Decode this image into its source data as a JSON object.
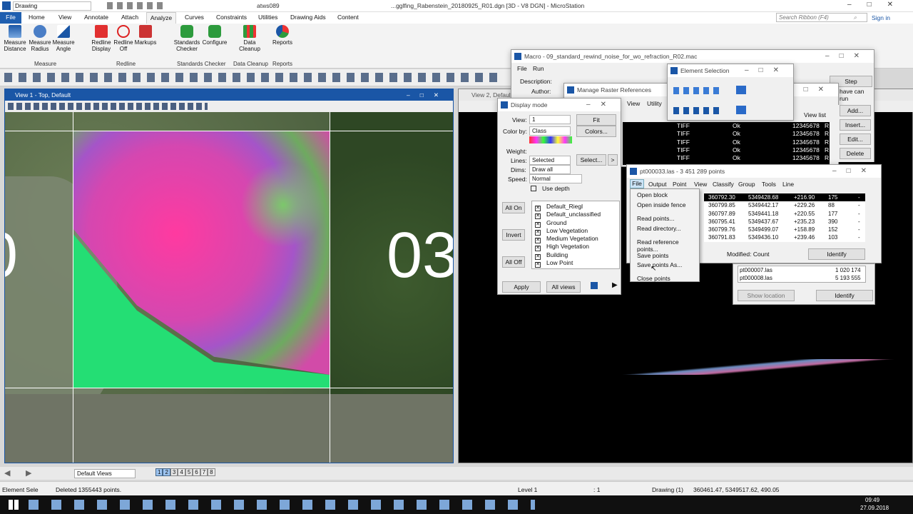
{
  "app": {
    "title": "atws089",
    "doc": "...gglfing_Rabenstein_20180925_R01.dgn [3D - V8 DGN] - MicroStation",
    "workflow": "Drawing",
    "search_placeholder": "Search Ribbon (F4)",
    "sign_in": "Sign in"
  },
  "tabs": [
    "File",
    "Home",
    "View",
    "Annotate",
    "Attach",
    "Analyze",
    "Curves",
    "Constraints",
    "Utilities",
    "Drawing Aids",
    "Content"
  ],
  "ribbon": {
    "buttons": [
      "Measure Distance",
      "Measure Radius",
      "Measure Angle",
      "Redline Display",
      "Redline Off",
      "Markups",
      "Standards Checker",
      "Configure",
      "Data Cleanup",
      "Reports"
    ],
    "groups": [
      "Measure",
      "Redline",
      "Standards Checker",
      "Data Cleanup",
      "Reports"
    ]
  },
  "view1": {
    "title": "View 1 - Top, Default",
    "overlay_text": "03",
    "overlay_text_left": "0"
  },
  "view2": {
    "title": "View 2, Default"
  },
  "macro": {
    "title": "Macro - 09_standard_rewind_noise_for_wo_refraction_R02.mac",
    "menu": [
      "File",
      "Run"
    ],
    "description_label": "Description:",
    "author_label": "Author:",
    "step": "Step",
    "run_note": "have can run"
  },
  "element_selection": {
    "title": "Element Selection"
  },
  "raster": {
    "title": "Manage Raster References",
    "menu": [
      "View",
      "Utility"
    ],
    "view_list": "View list",
    "buttons": [
      "Add...",
      "Insert...",
      "Edit...",
      "Delete"
    ],
    "rows": [
      [
        "TIFF",
        "Ok",
        "12345678",
        "R"
      ],
      [
        "TIFF",
        "Ok",
        "12345678",
        "R"
      ],
      [
        "TIFF",
        "Ok",
        "12345678",
        "R"
      ],
      [
        "TIFF",
        "Ok",
        "12345678",
        "R"
      ],
      [
        "TIFF",
        "Ok",
        "12345678",
        "R"
      ]
    ]
  },
  "display_mode": {
    "title": "Display mode",
    "labels": [
      "View:",
      "Color by:",
      "Weight:",
      "Lines:",
      "Dims:",
      "Speed:"
    ],
    "values": {
      "view": "1",
      "color_by": "Class",
      "lines": "Selected",
      "dims": "Draw all",
      "speed": "Normal"
    },
    "fit": "Fit",
    "colors": "Colors...",
    "select": "Select...",
    "use_depth": "Use depth",
    "side_buttons": [
      "All On",
      "Invert",
      "All Off"
    ],
    "classes": [
      "Default_Riegl",
      "Default_unclassified",
      "Ground",
      "Low Vegetation",
      "Medium Vegetation",
      "High Vegetation",
      "Building",
      "Low Point"
    ],
    "apply": "Apply",
    "all_views": "All views"
  },
  "points_window": {
    "title": "pt000033.las - 3 451 289 points",
    "menu": [
      "File",
      "Output",
      "Point",
      "View",
      "Classify",
      "Group",
      "Tools",
      "Line"
    ],
    "file_menu": [
      "Open block",
      "Open inside fence",
      "Read points...",
      "Read directory...",
      "Read reference points...",
      "Save points",
      "Save points As...",
      "Close points"
    ],
    "rows": [
      [
        "360792.30",
        "5349428.68",
        "+216.90",
        "175",
        "-"
      ],
      [
        "360799.85",
        "5349442.17",
        "+229.26",
        "88",
        "-"
      ],
      [
        "360797.89",
        "5349441.18",
        "+220.55",
        "177",
        "-"
      ],
      [
        "360795.41",
        "5349437.67",
        "+235.23",
        "390",
        "-"
      ],
      [
        "360799.76",
        "5349499.07",
        "+158.89",
        "152",
        "-"
      ],
      [
        "360791.83",
        "5349436.10",
        "+239.46",
        "103",
        "-"
      ]
    ],
    "modified": "Modified: Count",
    "identify": "Identify"
  },
  "files_panel": {
    "rows": [
      [
        "pt000007.las",
        "1 020 174"
      ],
      [
        "pt000008.las",
        "5 193 555"
      ]
    ],
    "show_location": "Show location",
    "identify": "Identify"
  },
  "viewbar": {
    "label": "Default Views",
    "numbers": [
      "1",
      "2",
      "3",
      "4",
      "5",
      "6",
      "7",
      "8"
    ]
  },
  "status": {
    "tool": "Element Sele",
    "message": "Deleted 1355443 points.",
    "level": "Level 1",
    "selection": ": 1",
    "model": "Drawing (1)",
    "coords": "360461.47, 5349517.62, 490.05"
  },
  "taskbar": {
    "time": "09:49",
    "date": "27.09.2018"
  },
  "colors": {
    "accent": "#1a56a6",
    "file_tab": "#1f5fb0",
    "pink": "#e0449a",
    "green": "#28e07a",
    "black": "#000000"
  }
}
